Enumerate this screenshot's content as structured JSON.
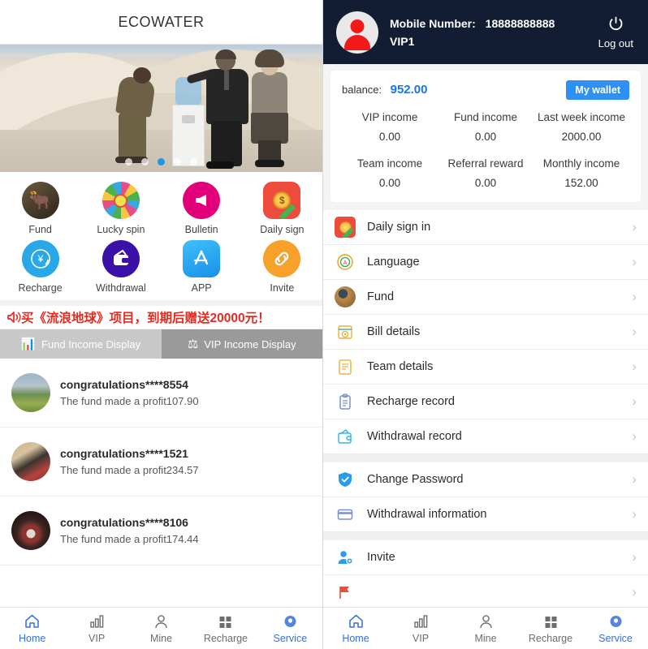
{
  "left": {
    "header": {
      "title": "ECOWATER"
    },
    "banner": {
      "name": "promo-carousel",
      "dots_count": 5,
      "active_dot": 3
    },
    "quick_icons": [
      {
        "label": "Fund",
        "icon": "fund-bull-icon"
      },
      {
        "label": "Lucky spin",
        "icon": "lucky-wheel-icon"
      },
      {
        "label": "Bulletin",
        "icon": "megaphone-icon"
      },
      {
        "label": "Daily sign",
        "icon": "sign-in-coin-icon"
      },
      {
        "label": "Recharge",
        "icon": "yen-refresh-icon"
      },
      {
        "label": "Withdrawal",
        "icon": "wallet-icon"
      },
      {
        "label": "APP",
        "icon": "app-store-icon"
      },
      {
        "label": "Invite",
        "icon": "link-chain-icon"
      }
    ],
    "notice": {
      "icon": "speaker-horn-icon",
      "text": "买《流浪地球》项目，到期后赠送20000元！"
    },
    "tabs": [
      {
        "label": "Fund Income Display",
        "icon": "bar-chart-icon",
        "active": false
      },
      {
        "label": "VIP Income Display",
        "icon": "scales-icon",
        "active": true
      }
    ],
    "congrats": [
      {
        "title": "congratulations****8554",
        "subtitle": "The fund made a profit107.90",
        "avatar": "landscape-avatar"
      },
      {
        "title": "congratulations****1521",
        "subtitle": "The fund made a profit234.57",
        "avatar": "portrait-avatar"
      },
      {
        "title": "congratulations****8106",
        "subtitle": "The fund made a profit174.44",
        "avatar": "performer-avatar"
      }
    ],
    "bottom_nav": [
      {
        "label": "Home",
        "icon": "home-icon",
        "active": true
      },
      {
        "label": "VIP",
        "icon": "chart-bars-icon",
        "active": false
      },
      {
        "label": "Mine",
        "icon": "person-icon",
        "active": false
      },
      {
        "label": "Recharge",
        "icon": "grid-squares-icon",
        "active": false
      },
      {
        "label": "Service",
        "icon": "headset-icon",
        "active": true
      }
    ]
  },
  "right": {
    "header": {
      "mobile_label": "Mobile Number:",
      "mobile_value": "18888888888",
      "vip_level": "VIP1",
      "logout_label": "Log out",
      "logout_icon": "power-icon",
      "avatar_icon": "user-avatar-icon"
    },
    "wallet": {
      "balance_label": "balance:",
      "balance_value": "952.00",
      "wallet_button": "My wallet",
      "incomes": [
        {
          "name": "VIP income",
          "value": "0.00"
        },
        {
          "name": "Fund income",
          "value": "0.00"
        },
        {
          "name": "Last week income",
          "value": "2000.00"
        },
        {
          "name": "Team income",
          "value": "0.00"
        },
        {
          "name": "Referral reward",
          "value": "0.00"
        },
        {
          "name": "Monthly income",
          "value": "152.00"
        }
      ]
    },
    "menu_group_1": [
      {
        "label": "Daily sign in",
        "icon": "sign-in-coin-icon"
      },
      {
        "label": "Language",
        "icon": "language-globe-icon"
      },
      {
        "label": "Fund",
        "icon": "fund-photo-icon"
      },
      {
        "label": "Bill details",
        "icon": "bill-calendar-icon"
      },
      {
        "label": "Team details",
        "icon": "team-document-icon"
      },
      {
        "label": "Recharge record",
        "icon": "clipboard-icon"
      },
      {
        "label": "Withdrawal record",
        "icon": "wallet-out-icon"
      }
    ],
    "menu_group_2": [
      {
        "label": "Change Password",
        "icon": "shield-check-icon"
      },
      {
        "label": "Withdrawal information",
        "icon": "bank-card-icon"
      }
    ],
    "menu_group_3": [
      {
        "label": "Invite",
        "icon": "add-user-icon"
      }
    ],
    "chevron": "›",
    "bottom_nav": [
      {
        "label": "Home",
        "icon": "home-icon",
        "active": true
      },
      {
        "label": "VIP",
        "icon": "chart-bars-icon",
        "active": false
      },
      {
        "label": "Mine",
        "icon": "person-icon",
        "active": false
      },
      {
        "label": "Recharge",
        "icon": "grid-squares-icon",
        "active": false
      },
      {
        "label": "Service",
        "icon": "headset-icon",
        "active": true
      }
    ]
  },
  "colors": {
    "header_dark": "#121c33",
    "accent_blue": "#2f90f4",
    "balance_blue": "#1a74e8",
    "notice_red": "#e8291f",
    "nav_active": "#3a6fd8"
  }
}
